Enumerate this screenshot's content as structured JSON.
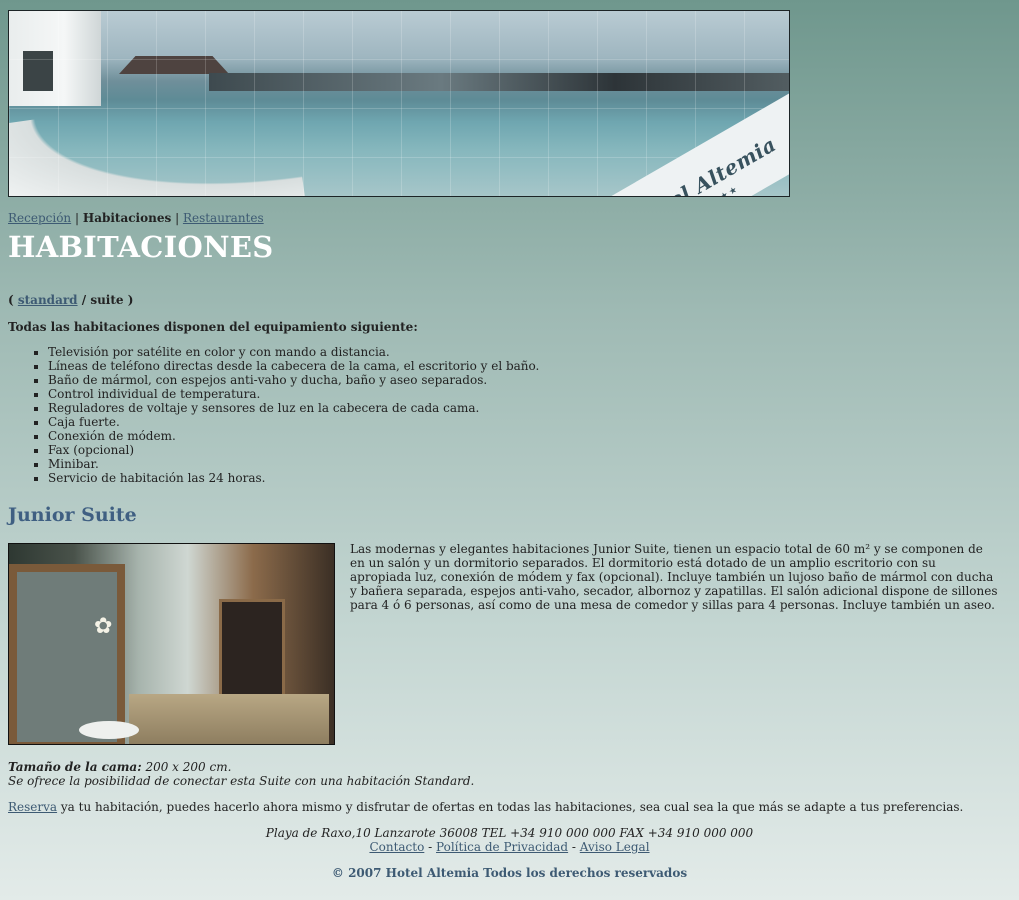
{
  "banner": {
    "logo_text": "Hotel Altemia",
    "logo_stars": "★★★★"
  },
  "nav": {
    "items": [
      {
        "label": "Recepción",
        "link": true
      },
      {
        "label": "Habitaciones",
        "link": false
      },
      {
        "label": "Restaurantes",
        "link": true
      }
    ],
    "separator": "|"
  },
  "page_title": "HABITACIONES",
  "subnav": {
    "open": "(",
    "standard": "standard",
    "slash": "/",
    "suite": "suite",
    "close": ")"
  },
  "intro": "Todas las habitaciones disponen del equipamiento siguiente:",
  "features": [
    "Televisión por satélite en color y con mando a distancia.",
    "Líneas de teléfono directas desde la cabecera de la cama, el escritorio y el baño.",
    "Baño de mármol, con espejos anti-vaho y ducha, baño y aseo separados.",
    "Control individual de temperatura.",
    "Reguladores de voltaje y sensores de luz en la cabecera de cada cama.",
    "Caja fuerte.",
    "Conexión de módem.",
    "Fax (opcional)",
    "Minibar.",
    "Servicio de habitación las 24 horas."
  ],
  "section_title": "Junior Suite",
  "description": "Las modernas y elegantes habitaciones Junior Suite, tienen un espacio total de 60 m² y se componen de en un salón y un dormitorio separados. El dormitorio está dotado de un amplio escritorio con su apropiada luz, conexión de módem y fax (opcional). Incluye también un lujoso baño de mármol con ducha y bañera separada, espejos anti-vaho, secador, albornoz y zapatillas. El salón adicional dispone de sillones para 4 ó 6 personas, así como de una mesa de comedor y sillas para 4 personas. Incluye también un aseo.",
  "bed": {
    "label": "Tamaño de la cama:",
    "value": " 200 x 200 cm.",
    "note": "Se ofrece la posibilidad de conectar esta Suite con una habitación Standard."
  },
  "reserve": {
    "link": "Reserva",
    "text": " ya tu habitación, puedes hacerlo ahora mismo y disfrutar de ofertas en todas las habitaciones, sea cual sea la que más se adapte a tus preferencias."
  },
  "footer": {
    "address": "Playa de Raxo,10 Lanzarote 36008 TEL +34 910 000 000 FAX +34 910 000 000",
    "links": [
      "Contacto",
      "Política de Privacidad",
      "Aviso Legal"
    ],
    "link_sep": " - ",
    "copyright": "© 2007 Hotel Altemia Todos los derechos reservados"
  }
}
